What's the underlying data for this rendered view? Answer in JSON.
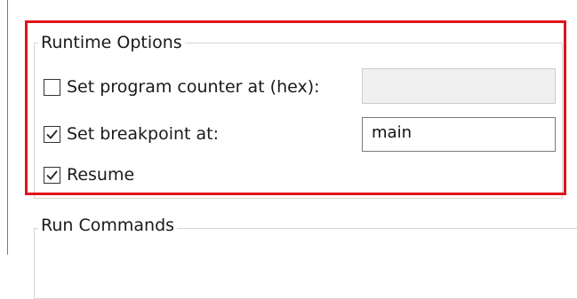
{
  "runtime_options": {
    "title": "Runtime Options",
    "set_pc": {
      "label": "Set program counter at (hex):",
      "checked": false,
      "value": ""
    },
    "set_breakpoint": {
      "label": "Set breakpoint at:",
      "checked": true,
      "value": "main"
    },
    "resume": {
      "label": "Resume",
      "checked": true
    }
  },
  "run_commands": {
    "title": "Run Commands"
  },
  "colors": {
    "highlight": "#e0141b",
    "group_border": "#d5d5d5"
  }
}
